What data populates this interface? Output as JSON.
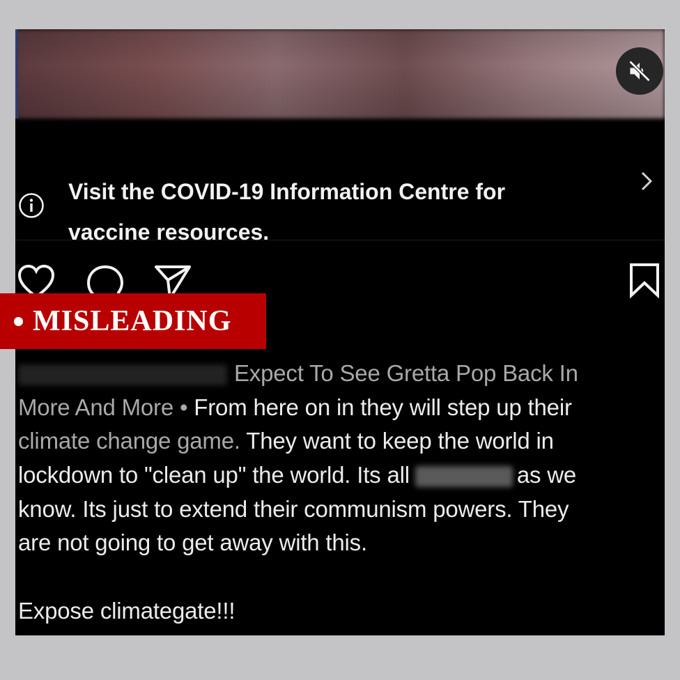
{
  "post": {
    "media": {
      "mute_icon": "speaker-muted-icon"
    },
    "info_banner": {
      "icon": "info-circle-icon",
      "line1": "Visit the COVID-19 Information Centre for",
      "line2": "vaccine resources.",
      "chevron": "chevron-right-icon"
    },
    "actions": {
      "like_icon": "heart-icon",
      "comment_icon": "comment-icon",
      "share_icon": "send-icon",
      "save_icon": "bookmark-icon"
    },
    "caption": {
      "line1": "Expect To See Gretta Pop Back In",
      "line2a": "More And More •",
      "line2b": " From here on in they will step up their",
      "line3a": "climate change game.",
      "line3b": " They want to keep the world in",
      "line4a": "lockdown to \"clean up\" the world. Its all",
      "line4b": "as we",
      "line5": "know. Its just to extend their communism powers. They",
      "line6": "are not going to get away with this.",
      "line7": "Expose climategate!!!"
    }
  },
  "label": {
    "text": "MISLEADING",
    "color": "#b80000"
  }
}
